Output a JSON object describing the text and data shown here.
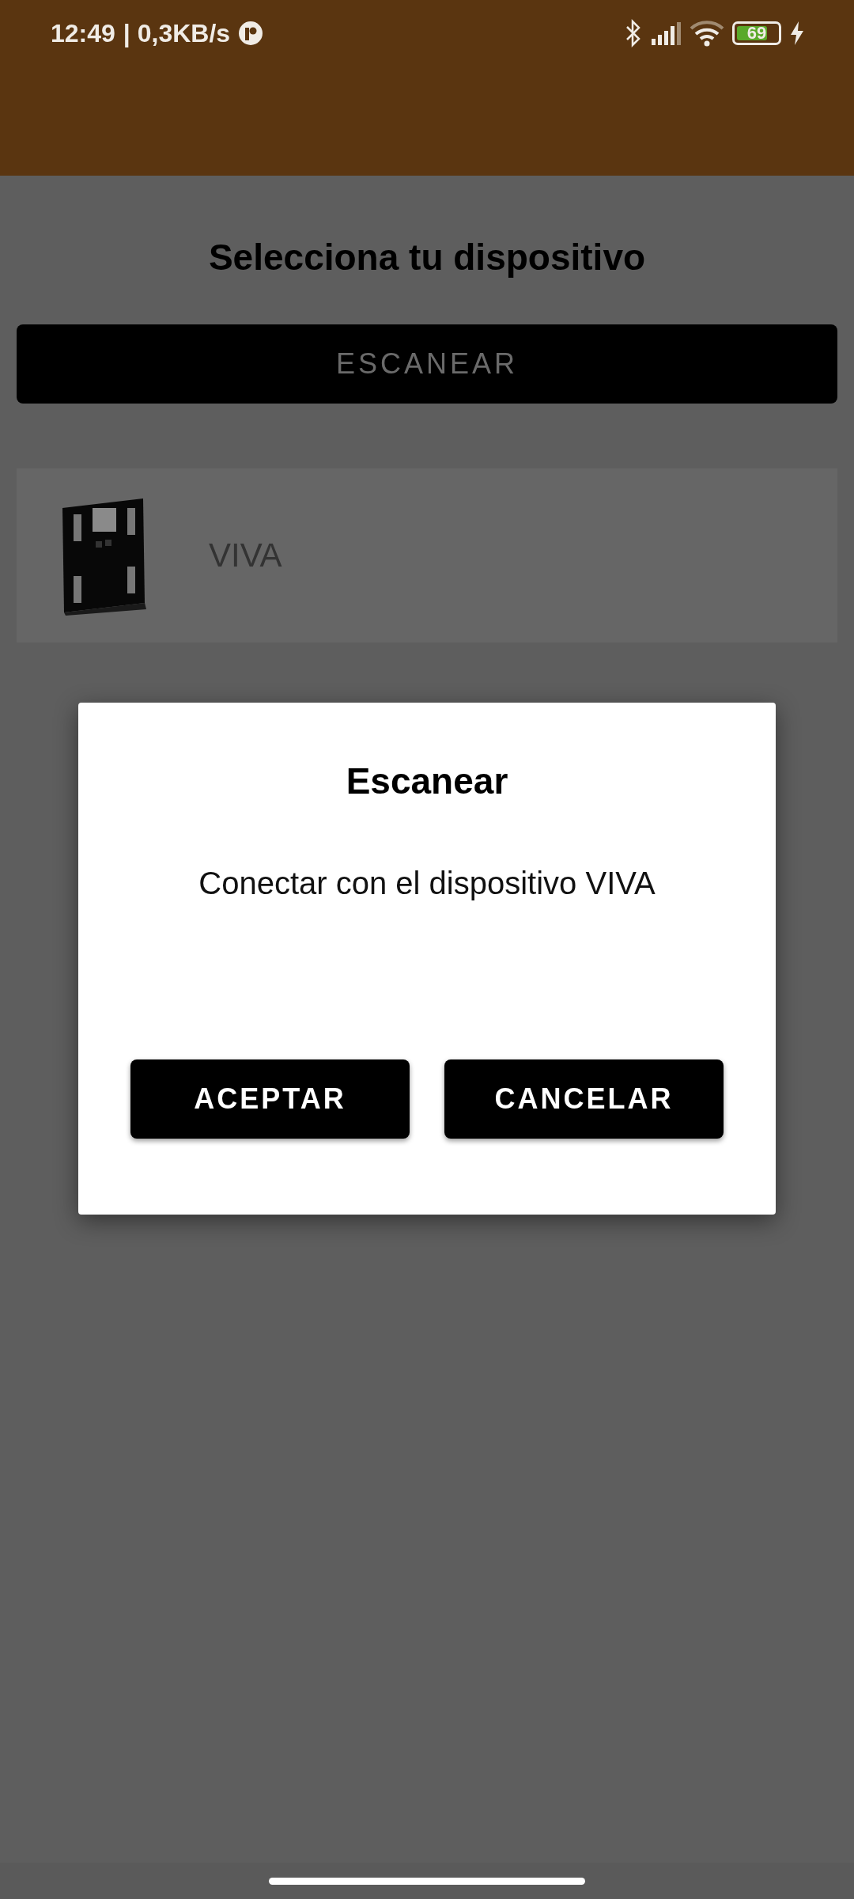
{
  "status_bar": {
    "time": "12:49",
    "speed": "| 0,3KB/s",
    "battery": "69"
  },
  "title": "Selecciona tu dispositivo",
  "scan_button": "ESCANEAR",
  "devices": [
    {
      "name": "VIVA",
      "kind": "picture"
    }
  ],
  "dialog": {
    "title": "Escanear",
    "message": "Conectar con el dispositivo VIVA",
    "buttons": [
      "ACEPTAR",
      "CANCELAR"
    ]
  }
}
